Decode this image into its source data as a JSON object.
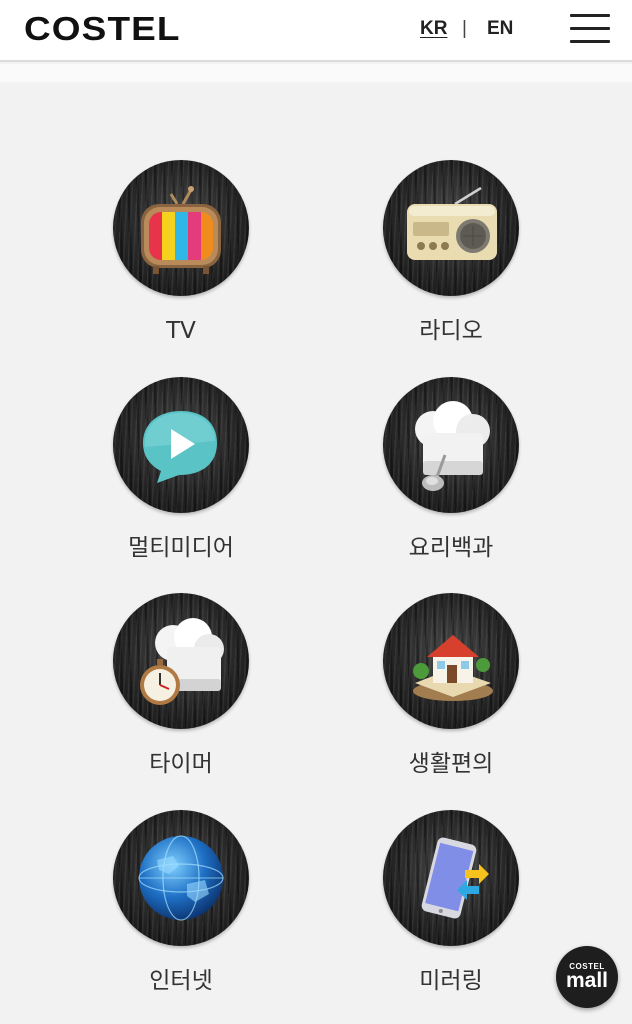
{
  "header": {
    "logo": "COSTEL",
    "lang_kr": "KR",
    "lang_separator": "|",
    "lang_en": "EN",
    "menu_icon": "hamburger-menu-icon"
  },
  "categories": [
    {
      "label": "TV",
      "icon": "tv-icon"
    },
    {
      "label": "라디오",
      "icon": "radio-icon"
    },
    {
      "label": "멀티미디어",
      "icon": "play-bubble-icon"
    },
    {
      "label": "요리백과",
      "icon": "chef-hat-icon"
    },
    {
      "label": "타이머",
      "icon": "timer-chef-hat-icon"
    },
    {
      "label": "생활편의",
      "icon": "house-icon"
    },
    {
      "label": "인터넷",
      "icon": "globe-icon"
    },
    {
      "label": "미러링",
      "icon": "phone-mirroring-icon"
    }
  ],
  "mall_button": {
    "top_text": "COSTEL",
    "bottom_text": "mall"
  }
}
